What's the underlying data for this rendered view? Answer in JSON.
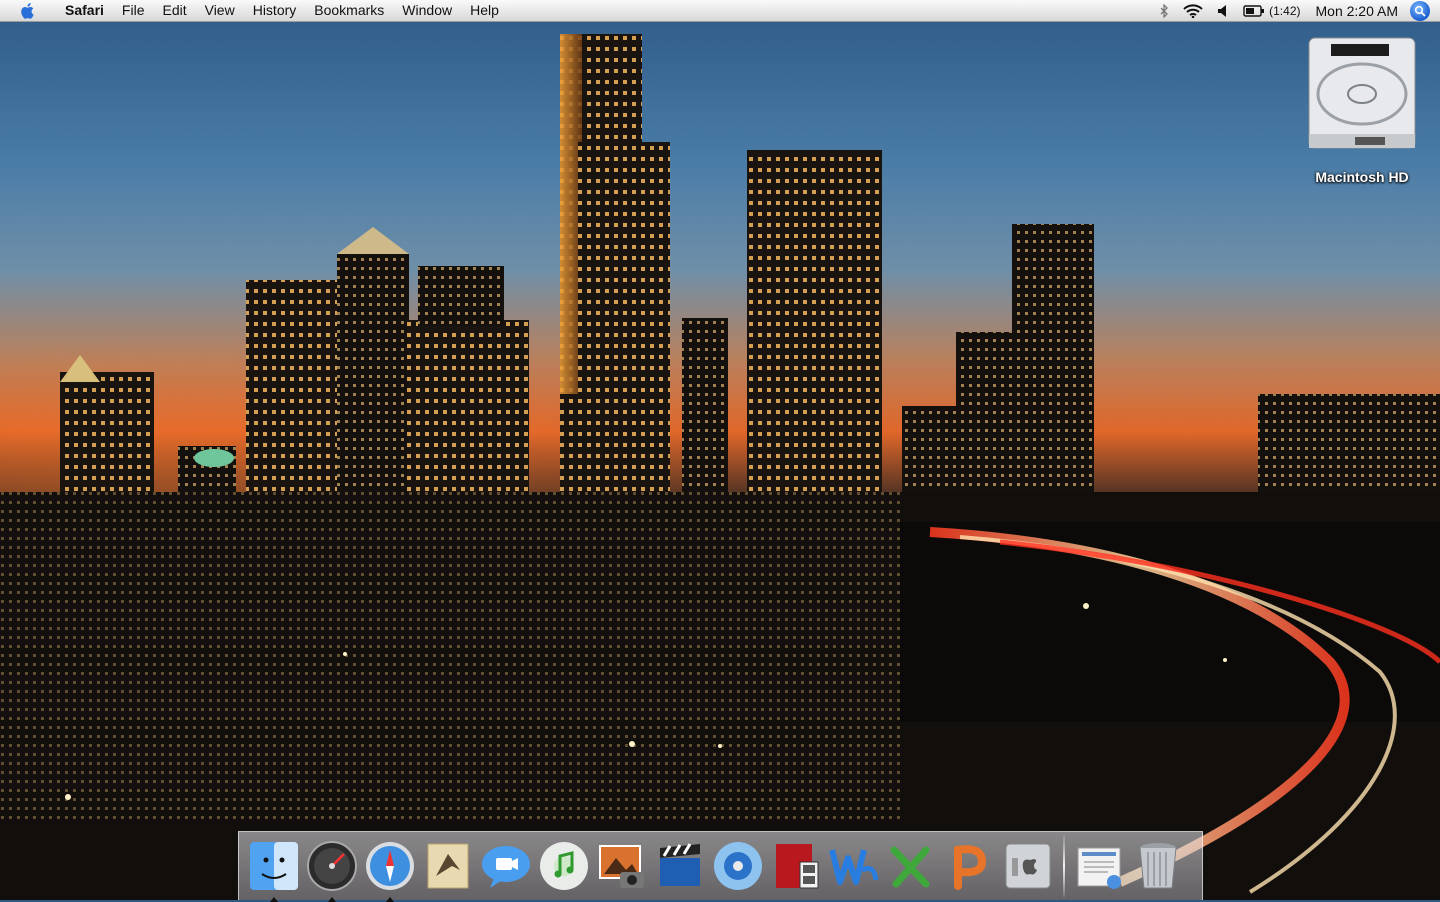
{
  "menubar": {
    "app_name": "Safari",
    "items": [
      "File",
      "Edit",
      "View",
      "History",
      "Bookmarks",
      "Window",
      "Help"
    ],
    "battery_time": "(1:42)",
    "clock": "Mon 2:20 AM"
  },
  "desktop": {
    "icons": [
      {
        "label": "Macintosh HD",
        "icon": "hard-drive-icon"
      }
    ]
  },
  "dock": {
    "apps": [
      {
        "name": "finder",
        "icon": "finder-icon",
        "running": true
      },
      {
        "name": "dashboard",
        "icon": "dashboard-icon",
        "running": true
      },
      {
        "name": "safari",
        "icon": "safari-icon",
        "running": true
      },
      {
        "name": "mail",
        "icon": "mail-icon",
        "running": false
      },
      {
        "name": "ichat",
        "icon": "ichat-icon",
        "running": false
      },
      {
        "name": "itunes",
        "icon": "itunes-icon",
        "running": false
      },
      {
        "name": "iphoto",
        "icon": "iphoto-icon",
        "running": false
      },
      {
        "name": "imovie",
        "icon": "imovie-icon",
        "running": false
      },
      {
        "name": "idvd",
        "icon": "idvd-icon",
        "running": false
      },
      {
        "name": "photo-booth",
        "icon": "photo-booth-icon",
        "running": false
      },
      {
        "name": "word",
        "icon": "word-icon",
        "running": false
      },
      {
        "name": "excel",
        "icon": "excel-icon",
        "running": false
      },
      {
        "name": "powerpoint",
        "icon": "powerpoint-icon",
        "running": false
      },
      {
        "name": "system-preferences",
        "icon": "system-preferences-icon",
        "running": false
      }
    ],
    "docs": [
      {
        "name": "downloads-stack",
        "icon": "document-icon"
      },
      {
        "name": "trash",
        "icon": "trash-icon"
      }
    ]
  },
  "colors": {
    "menubar_bg": "#e9e9e9",
    "sky_top": "#2e5a86",
    "sunset": "#e0672a"
  }
}
